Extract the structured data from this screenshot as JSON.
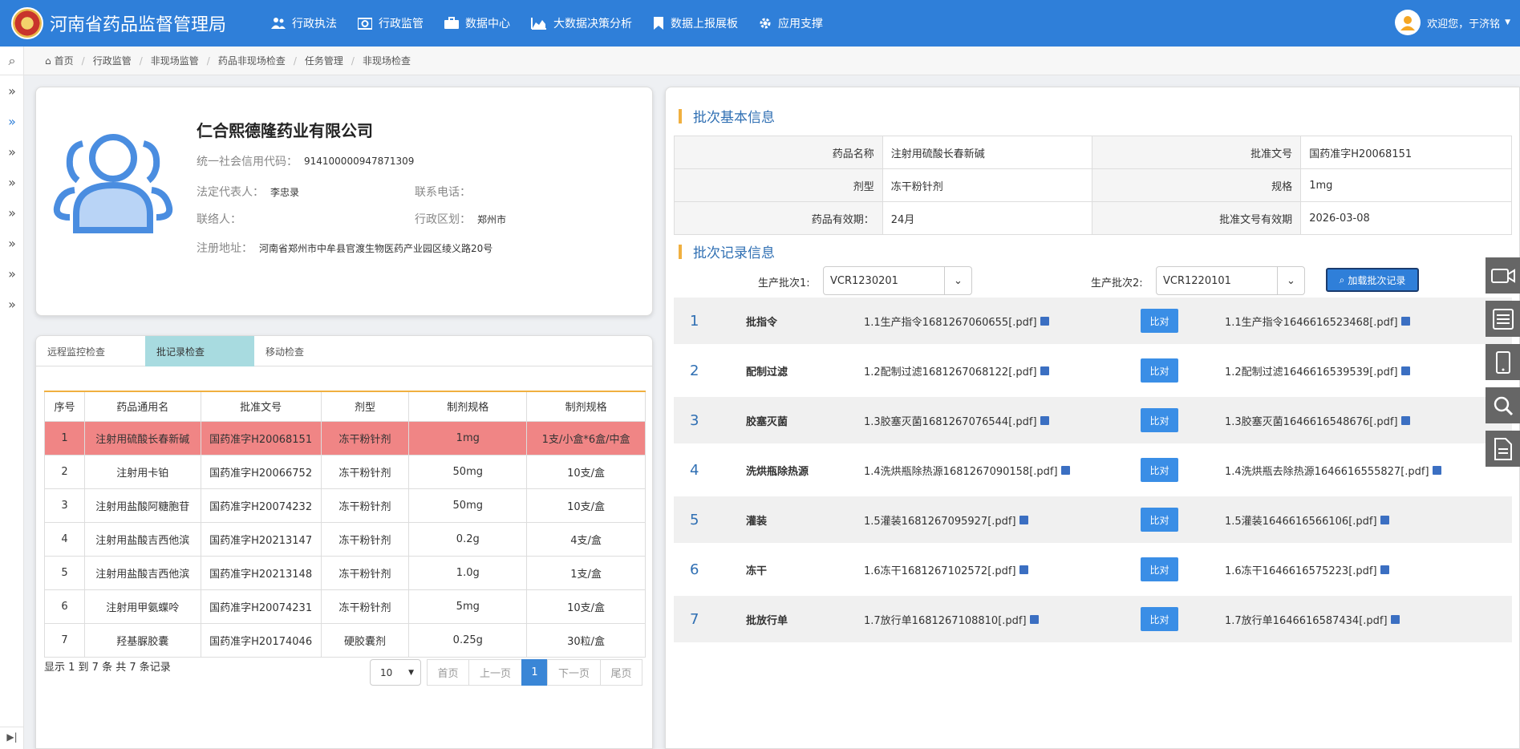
{
  "header": {
    "title": "河南省药品监督管理局",
    "nav": [
      "行政执法",
      "行政监管",
      "数据中心",
      "大数据决策分析",
      "数据上报展板",
      "应用支撑"
    ],
    "user_greeting": "欢迎您，于济铭"
  },
  "breadcrumb": [
    "首页",
    "行政监管",
    "非现场监管",
    "药品非现场检查",
    "任务管理",
    "非现场检查"
  ],
  "company": {
    "name": "仁合熙德隆药业有限公司",
    "credit_code_label": "统一社会信用代码：",
    "credit_code": "914100000947871309",
    "legal_rep_label": "法定代表人：",
    "legal_rep": "李忠录",
    "phone_label": "联系电话：",
    "phone": "",
    "contact_label": "联络人：",
    "contact": "",
    "district_label": "行政区划：",
    "district": "郑州市",
    "address_label": "注册地址：",
    "address": "河南省郑州市中牟县官渡生物医药产业园区绫义路20号"
  },
  "tabs": [
    "远程监控检查",
    "批记录检查",
    "移动检查"
  ],
  "drug_table": {
    "headers": [
      "序号",
      "药品通用名",
      "批准文号",
      "剂型",
      "制剂规格",
      "制剂规格"
    ],
    "rows": [
      [
        "1",
        "注射用硫酸长春新碱",
        "国药准字H20068151",
        "冻干粉针剂",
        "1mg",
        "1支/小盒*6盒/中盒"
      ],
      [
        "2",
        "注射用卡铂",
        "国药准字H20066752",
        "冻干粉针剂",
        "50mg",
        "10支/盒"
      ],
      [
        "3",
        "注射用盐酸阿糖胞苷",
        "国药准字H20074232",
        "冻干粉针剂",
        "50mg",
        "10支/盒"
      ],
      [
        "4",
        "注射用盐酸吉西他滨",
        "国药准字H20213147",
        "冻干粉针剂",
        "0.2g",
        "4支/盒"
      ],
      [
        "5",
        "注射用盐酸吉西他滨",
        "国药准字H20213148",
        "冻干粉针剂",
        "1.0g",
        "1支/盒"
      ],
      [
        "6",
        "注射用甲氨蝶呤",
        "国药准字H20074231",
        "冻干粉针剂",
        "5mg",
        "10支/盒"
      ],
      [
        "7",
        "羟基脲胶囊",
        "国药准字H20174046",
        "硬胶囊剂",
        "0.25g",
        "30粒/盒"
      ]
    ],
    "summary": "显示 1 到 7 条 共 7 条记录",
    "page_size": "10",
    "pager": [
      "首页",
      "上一页",
      "1",
      "下一页",
      "尾页"
    ]
  },
  "batch_basic": {
    "title": "批次基本信息",
    "rows": [
      [
        "药品名称",
        "注射用硫酸长春新碱",
        "批准文号",
        "国药准字H20068151"
      ],
      [
        "剂型",
        "冻干粉针剂",
        "规格",
        "1mg"
      ],
      [
        "药品有效期：",
        "24月",
        "批准文号有效期",
        "2026-03-08"
      ]
    ]
  },
  "batch_records": {
    "title": "批次记录信息",
    "batch1_label": "生产批次1:",
    "batch1_value": "VCR1230201",
    "batch2_label": "生产批次2:",
    "batch2_value": "VCR1220101",
    "load_button": "加载批次记录",
    "compare_label": "比对",
    "items": [
      {
        "num": "1",
        "name": "批指令",
        "file1": "1.1生产指令1681267060655[.pdf]",
        "file2": "1.1生产指令1646616523468[.pdf]"
      },
      {
        "num": "2",
        "name": "配制过滤",
        "file1": "1.2配制过滤1681267068122[.pdf]",
        "file2": "1.2配制过滤1646616539539[.pdf]"
      },
      {
        "num": "3",
        "name": "胶塞灭菌",
        "file1": "1.3胶塞灭菌1681267076544[.pdf]",
        "file2": "1.3胶塞灭菌1646616548676[.pdf]"
      },
      {
        "num": "4",
        "name": "洗烘瓶除热源",
        "file1": "1.4洗烘瓶除热源1681267090158[.pdf]",
        "file2": "1.4洗烘瓶去除热源1646616555827[.pdf]"
      },
      {
        "num": "5",
        "name": "灌装",
        "file1": "1.5灌装1681267095927[.pdf]",
        "file2": "1.5灌装1646616566106[.pdf]"
      },
      {
        "num": "6",
        "name": "冻干",
        "file1": "1.6冻干1681267102572[.pdf]",
        "file2": "1.6冻干1646616575223[.pdf]"
      },
      {
        "num": "7",
        "name": "批放行单",
        "file1": "1.7放行单1681267108810[.pdf]",
        "file2": "1.7放行单1646616587434[.pdf]"
      }
    ]
  },
  "colors": {
    "header_bg": "#2f7fd9",
    "selected_row": "#f08585",
    "active_tab": "#a8dbe0",
    "accent_bar": "#f0b040"
  }
}
